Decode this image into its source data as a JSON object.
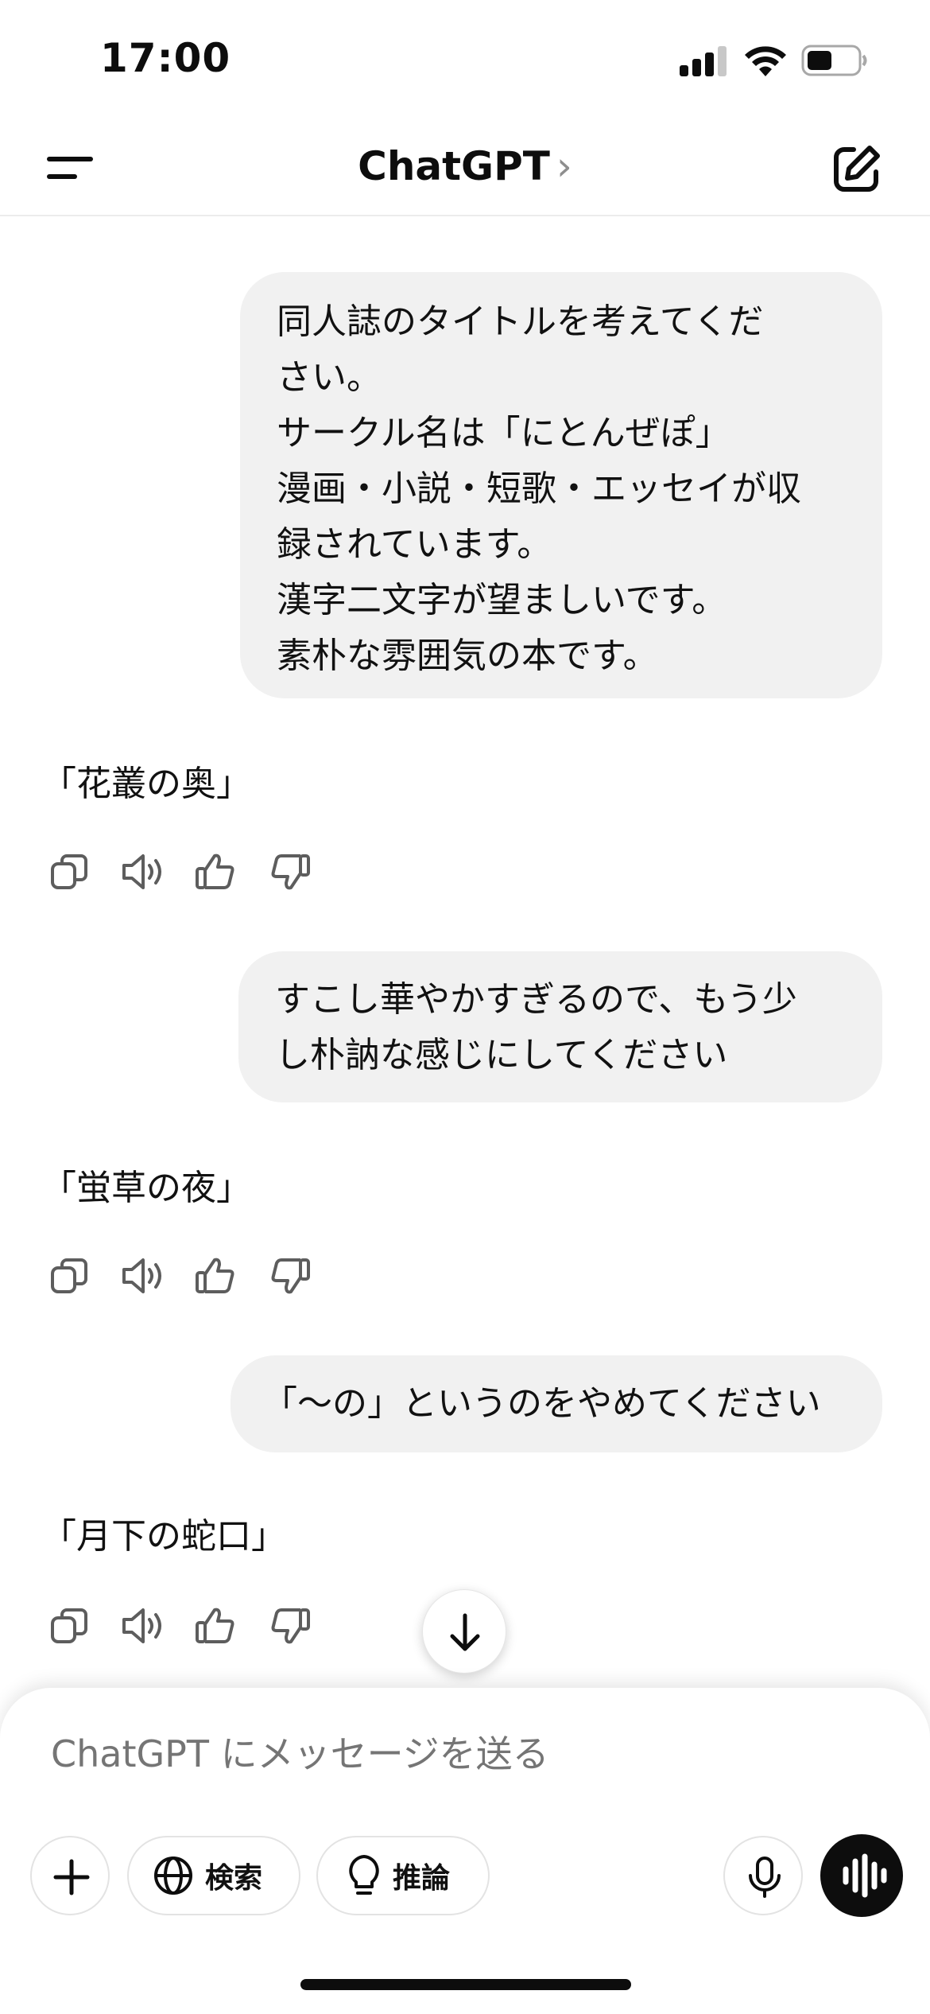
{
  "status_bar": {
    "time": "17:00"
  },
  "nav": {
    "title": "ChatGPT",
    "chevron": "›",
    "menu_icon": "menu-icon",
    "new_chat_icon": "new-chat-icon"
  },
  "conversation": {
    "user_1": [
      "同人誌のタイトルを考えてくだ",
      "さい。",
      "サークル名は「にとんぜぽ」",
      "漫画・小説・短歌・エッセイが収",
      "録されています。",
      "漢字二文字が望ましいです。",
      "素朴な雰囲気の本です。"
    ],
    "assistant_1": "「花叢の奥」",
    "user_2": [
      "すこし華やかすぎるので、もう少",
      "し朴訥な感じにしてください"
    ],
    "assistant_2": "「蛍草の夜」",
    "user_3": "「〜の」というのをやめてください",
    "assistant_3": "「月下の蛇口」",
    "action_icons": [
      "copy-icon",
      "read-aloud-icon",
      "thumbs-up-icon",
      "thumbs-down-icon"
    ]
  },
  "composer": {
    "placeholder": "ChatGPT にメッセージを送る",
    "search_label": "検索",
    "reason_label": "推論"
  }
}
